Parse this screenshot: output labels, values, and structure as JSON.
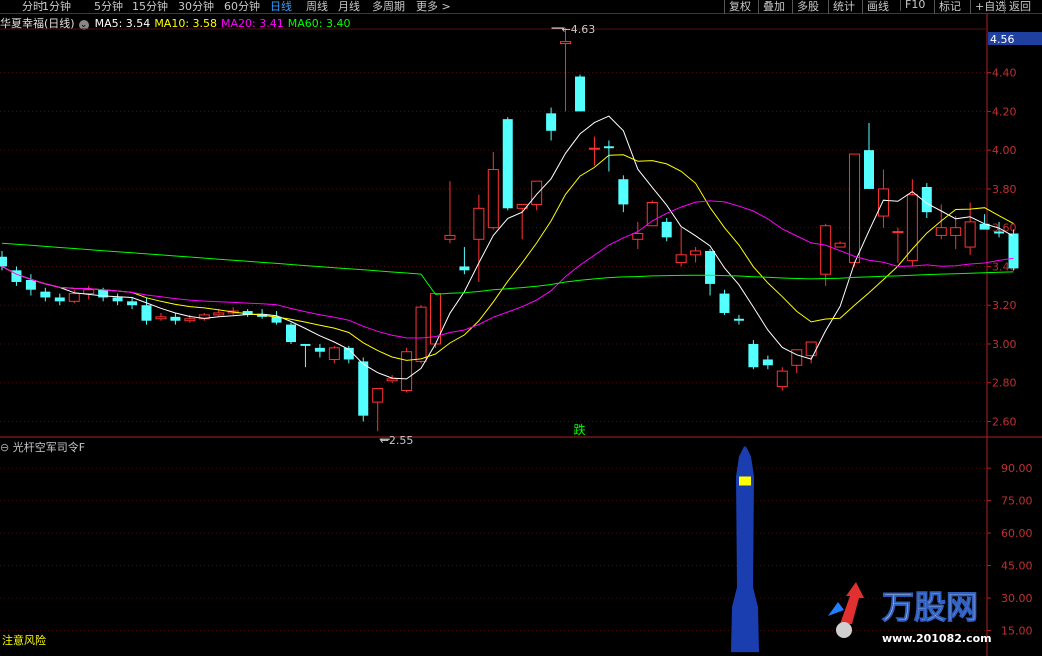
{
  "toolbar": {
    "periods": [
      "分时",
      "1分钟",
      "5分钟",
      "15分钟",
      "30分钟",
      "60分钟",
      "日线",
      "周线",
      "月线",
      "多周期",
      "更多 >"
    ],
    "active_period": "日线",
    "right_buttons": [
      "复权",
      "叠加",
      "多股",
      "统计",
      "画线",
      "F10",
      "标记",
      "+自选",
      "返回"
    ]
  },
  "legend": {
    "stock": "华夏幸福(日线)",
    "ma5": "MA5: 3.54",
    "ma10": "MA10: 3.58",
    "ma20": "MA20: 3.41",
    "ma60": "MA60: 3.40",
    "colors": {
      "ma5": "#ffffff",
      "ma10": "#ffff00",
      "ma20": "#ff00ff",
      "ma60": "#00ff00"
    }
  },
  "indicator": {
    "title": "光杆空军司令F",
    "warning": "注意风险",
    "marker": "跌"
  },
  "logo": {
    "brand": "万股网",
    "url": "www.201082.com"
  },
  "chart_data": [
    {
      "type": "candlestick",
      "title": "",
      "ylim": [
        2.52,
        4.62
      ],
      "price_ticks": [
        "4.40",
        "4.20",
        "4.00",
        "3.80",
        "3.60",
        "3.40",
        "3.20",
        "3.00",
        "2.80",
        "2.60"
      ],
      "current_price": "4.56",
      "annotations": {
        "high": "4.63",
        "low": "2.55"
      },
      "colors": {
        "up": "#ff3232",
        "down": "#54ffff"
      },
      "candles": [
        [
          3.45,
          3.48,
          3.38,
          3.4
        ],
        [
          3.38,
          3.4,
          3.3,
          3.32
        ],
        [
          3.33,
          3.36,
          3.25,
          3.28
        ],
        [
          3.27,
          3.29,
          3.22,
          3.24
        ],
        [
          3.24,
          3.26,
          3.2,
          3.22
        ],
        [
          3.22,
          3.28,
          3.21,
          3.26
        ],
        [
          3.26,
          3.3,
          3.23,
          3.28
        ],
        [
          3.28,
          3.29,
          3.22,
          3.24
        ],
        [
          3.24,
          3.26,
          3.2,
          3.22
        ],
        [
          3.22,
          3.24,
          3.18,
          3.2
        ],
        [
          3.2,
          3.24,
          3.1,
          3.12
        ],
        [
          3.13,
          3.16,
          3.12,
          3.14
        ],
        [
          3.14,
          3.16,
          3.1,
          3.12
        ],
        [
          3.12,
          3.15,
          3.11,
          3.13
        ],
        [
          3.13,
          3.16,
          3.12,
          3.15
        ],
        [
          3.15,
          3.18,
          3.14,
          3.16
        ],
        [
          3.16,
          3.19,
          3.15,
          3.17
        ],
        [
          3.17,
          3.18,
          3.14,
          3.15
        ],
        [
          3.15,
          3.18,
          3.13,
          3.14
        ],
        [
          3.14,
          3.17,
          3.1,
          3.11
        ],
        [
          3.1,
          3.11,
          3.0,
          3.01
        ],
        [
          3.0,
          3.0,
          2.88,
          2.99
        ],
        [
          2.98,
          3.0,
          2.93,
          2.96
        ],
        [
          2.92,
          2.99,
          2.9,
          2.98
        ],
        [
          2.98,
          2.99,
          2.9,
          2.92
        ],
        [
          2.91,
          2.93,
          2.6,
          2.63
        ],
        [
          2.7,
          2.75,
          2.55,
          2.77
        ],
        [
          2.81,
          2.84,
          2.8,
          2.82
        ],
        [
          2.76,
          2.98,
          2.75,
          2.96
        ],
        [
          2.91,
          3.2,
          2.9,
          3.19
        ],
        [
          3.0,
          3.26,
          2.98,
          3.26
        ],
        [
          3.54,
          3.84,
          3.52,
          3.56
        ],
        [
          3.4,
          3.5,
          3.36,
          3.38
        ],
        [
          3.54,
          3.77,
          3.32,
          3.7
        ],
        [
          3.6,
          3.99,
          3.59,
          3.9
        ],
        [
          4.16,
          4.17,
          3.69,
          3.7
        ],
        [
          3.7,
          3.72,
          3.54,
          3.72
        ],
        [
          3.72,
          3.84,
          3.69,
          3.84
        ],
        [
          4.19,
          4.22,
          4.05,
          4.1
        ],
        [
          4.55,
          4.63,
          4.2,
          4.56
        ],
        [
          4.38,
          4.39,
          4.2,
          4.2
        ],
        [
          4.01,
          4.07,
          3.92,
          4.01
        ],
        [
          4.02,
          4.05,
          3.89,
          4.01
        ],
        [
          3.85,
          3.87,
          3.68,
          3.72
        ],
        [
          3.54,
          3.63,
          3.49,
          3.57
        ],
        [
          3.61,
          3.74,
          3.62,
          3.73
        ],
        [
          3.63,
          3.65,
          3.53,
          3.55
        ],
        [
          3.42,
          3.6,
          3.4,
          3.46
        ],
        [
          3.46,
          3.5,
          3.42,
          3.48
        ],
        [
          3.48,
          3.49,
          3.25,
          3.31
        ],
        [
          3.26,
          3.28,
          3.15,
          3.16
        ],
        [
          3.13,
          3.15,
          3.1,
          3.12
        ],
        [
          3.0,
          3.02,
          2.87,
          2.88
        ],
        [
          2.92,
          2.94,
          2.87,
          2.89
        ],
        [
          2.78,
          2.88,
          2.76,
          2.86
        ],
        [
          2.89,
          2.97,
          2.85,
          2.97
        ],
        [
          2.94,
          3.0,
          2.9,
          3.01
        ],
        [
          3.36,
          3.62,
          3.3,
          3.61
        ],
        [
          3.5,
          3.53,
          3.5,
          3.52
        ],
        [
          3.42,
          3.98,
          3.4,
          3.98
        ],
        [
          4.0,
          4.14,
          3.8,
          3.8
        ],
        [
          3.66,
          3.9,
          3.6,
          3.8
        ],
        [
          3.58,
          3.6,
          3.42,
          3.58
        ],
        [
          3.43,
          3.85,
          3.4,
          3.77
        ],
        [
          3.81,
          3.83,
          3.65,
          3.68
        ],
        [
          3.56,
          3.72,
          3.54,
          3.6
        ],
        [
          3.56,
          3.66,
          3.49,
          3.6
        ],
        [
          3.5,
          3.73,
          3.46,
          3.63
        ],
        [
          3.62,
          3.67,
          3.6,
          3.59
        ],
        [
          3.58,
          3.63,
          3.55,
          3.57
        ],
        [
          3.57,
          3.59,
          3.38,
          3.39
        ]
      ]
    },
    {
      "type": "bar",
      "title": "光杆空军司令F",
      "ylim": [
        6,
        103
      ],
      "ticks": [
        "90.00",
        "75.00",
        "60.00",
        "45.00",
        "30.00",
        "15.00"
      ],
      "bar": {
        "value_top": 100,
        "value_bottom": 5,
        "color": "#1a3eb0"
      },
      "highlight_color": "#ffff00"
    }
  ]
}
